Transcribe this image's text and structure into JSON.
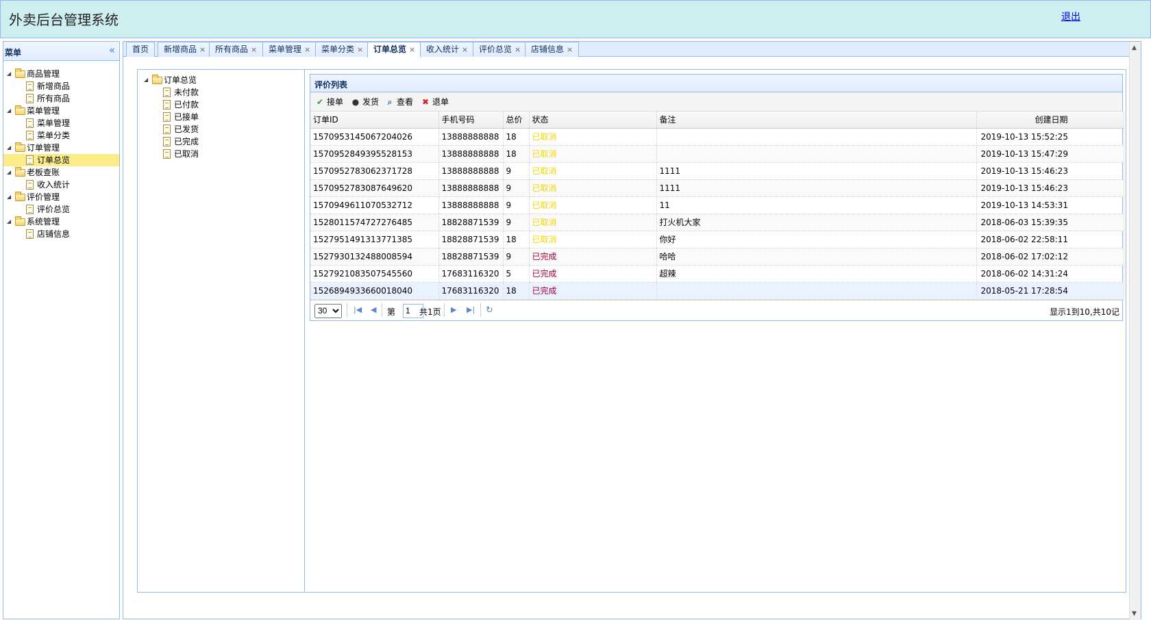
{
  "header": {
    "title": "外卖后台管理系统",
    "logout": "退出"
  },
  "menu": {
    "title": "菜单",
    "collapse_icon": "«",
    "groups": [
      {
        "label": "商品管理",
        "items": [
          "新增商品",
          "所有商品"
        ]
      },
      {
        "label": "菜单管理",
        "items": [
          "菜单管理",
          "菜单分类"
        ]
      },
      {
        "label": "订单管理",
        "items": [
          "订单总览"
        ]
      },
      {
        "label": "老板查账",
        "items": [
          "收入统计"
        ]
      },
      {
        "label": "评价管理",
        "items": [
          "评价总览"
        ]
      },
      {
        "label": "系统管理",
        "items": [
          "店铺信息"
        ]
      }
    ],
    "selected": "订单总览"
  },
  "tabs": [
    {
      "label": "首页",
      "closable": false
    },
    {
      "label": "新增商品",
      "closable": true
    },
    {
      "label": "所有商品",
      "closable": true
    },
    {
      "label": "菜单管理",
      "closable": true
    },
    {
      "label": "菜单分类",
      "closable": true
    },
    {
      "label": "订单总览",
      "closable": true,
      "active": true
    },
    {
      "label": "收入统计",
      "closable": true
    },
    {
      "label": "评价总览",
      "closable": true
    },
    {
      "label": "店铺信息",
      "closable": true
    }
  ],
  "order_tree": {
    "root": "订单总览",
    "children": [
      "未付款",
      "已付款",
      "已接单",
      "已发货",
      "已完成",
      "已取消"
    ]
  },
  "grid": {
    "title": "评价列表",
    "toolbar": [
      {
        "label": "接单",
        "icon": "check-icon"
      },
      {
        "label": "发货",
        "icon": "user-icon"
      },
      {
        "label": "查看",
        "icon": "search-icon"
      },
      {
        "label": "退单",
        "icon": "cross-icon"
      }
    ],
    "columns": [
      "订单ID",
      "手机号码",
      "总价",
      "状态",
      "备注",
      "创建日期"
    ],
    "rows": [
      [
        "1570953145067204026",
        "13888888888",
        "18",
        "已取消",
        "",
        "2019-10-13 15:52:25"
      ],
      [
        "1570952849395528153",
        "13888888888",
        "18",
        "已取消",
        "",
        "2019-10-13 15:47:29"
      ],
      [
        "1570952783062371728",
        "13888888888",
        "9",
        "已取消",
        "1111",
        "2019-10-13 15:46:23"
      ],
      [
        "1570952783087649620",
        "13888888888",
        "9",
        "已取消",
        "1111",
        "2019-10-13 15:46:23"
      ],
      [
        "1570949611070532712",
        "13888888888",
        "9",
        "已取消",
        "11",
        "2019-10-13 14:53:31"
      ],
      [
        "1528011574727276485",
        "18828871539",
        "9",
        "已取消",
        "打火机大家",
        "2018-06-03 15:39:35"
      ],
      [
        "1527951491313771385",
        "18828871539",
        "18",
        "已取消",
        "你好",
        "2018-06-02 22:58:11"
      ],
      [
        "1527930132488008594",
        "18828871539",
        "9",
        "已完成",
        "哈哈",
        "2018-06-02 17:02:12"
      ],
      [
        "1527921083507545560",
        "17683116320",
        "5",
        "已完成",
        "超辣",
        "2018-06-02 14:31:24"
      ],
      [
        "1526894933660018040",
        "17683116320",
        "18",
        "已完成",
        "",
        "2018-05-21 17:28:54"
      ]
    ],
    "status_colors": {
      "已取消": "#f2d600",
      "已完成": "#a5003a"
    },
    "pager": {
      "page_size": "30",
      "page_prefix": "第",
      "page_value": "1",
      "page_suffix": "共1页",
      "info": "显示1到10,共10记"
    }
  }
}
